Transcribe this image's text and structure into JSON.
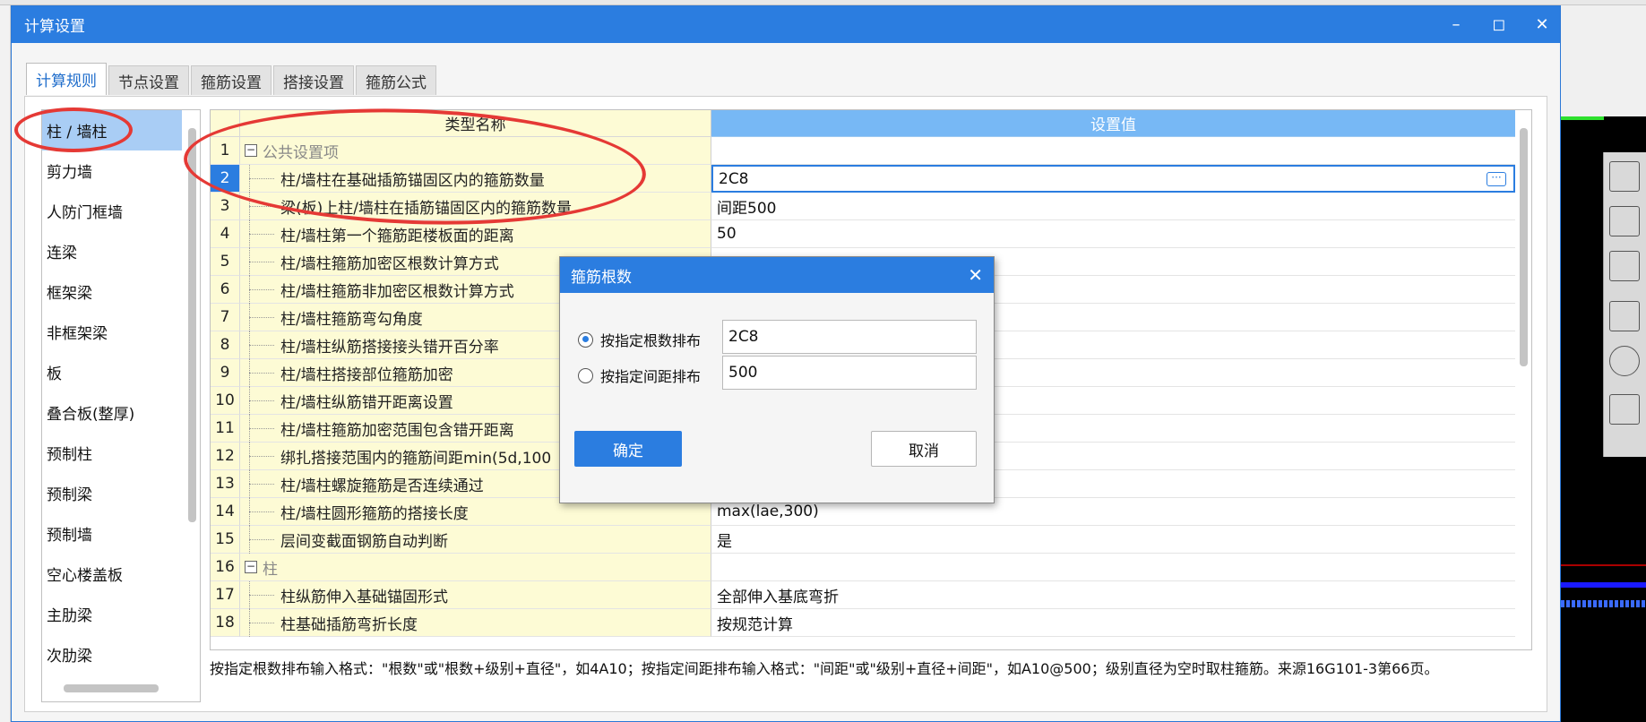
{
  "window": {
    "title": "计算设置"
  },
  "tabs": [
    {
      "label": "计算规则"
    },
    {
      "label": "节点设置"
    },
    {
      "label": "箍筋设置"
    },
    {
      "label": "搭接设置"
    },
    {
      "label": "箍筋公式"
    }
  ],
  "categories": [
    "柱 / 墙柱",
    "剪力墙",
    "人防门框墙",
    "连梁",
    "框架梁",
    "非框架梁",
    "板",
    "叠合板(整厚)",
    "预制柱",
    "预制梁",
    "预制墙",
    "空心楼盖板",
    "主肋梁",
    "次肋梁"
  ],
  "grid": {
    "col_name": "类型名称",
    "col_value": "设置值",
    "rows": [
      {
        "num": "1",
        "name": "公共设置项",
        "value": "",
        "group": true
      },
      {
        "num": "2",
        "name": "柱/墙柱在基础插筋锚固区内的箍筋数量",
        "value": "2C8",
        "selected": true
      },
      {
        "num": "3",
        "name": "梁(板)上柱/墙柱在插筋锚固区内的箍筋数量",
        "value": "间距500"
      },
      {
        "num": "4",
        "name": "柱/墙柱第一个箍筋距楼板面的距离",
        "value": "50"
      },
      {
        "num": "5",
        "name": "柱/墙柱箍筋加密区根数计算方式",
        "value": ""
      },
      {
        "num": "6",
        "name": "柱/墙柱箍筋非加密区根数计算方式",
        "value": ""
      },
      {
        "num": "7",
        "name": "柱/墙柱箍筋弯勾角度",
        "value": ""
      },
      {
        "num": "8",
        "name": "柱/墙柱纵筋搭接接头错开百分率",
        "value": ""
      },
      {
        "num": "9",
        "name": "柱/墙柱搭接部位箍筋加密",
        "value": ""
      },
      {
        "num": "10",
        "name": "柱/墙柱纵筋错开距离设置",
        "value": ""
      },
      {
        "num": "11",
        "name": "柱/墙柱箍筋加密范围包含错开距离",
        "value": ""
      },
      {
        "num": "12",
        "name": "绑扎搭接范围内的箍筋间距min(5d,100",
        "value": ""
      },
      {
        "num": "13",
        "name": "柱/墙柱螺旋箍筋是否连续通过",
        "value": ""
      },
      {
        "num": "14",
        "name": "柱/墙柱圆形箍筋的搭接长度",
        "value": "max(lae,300)"
      },
      {
        "num": "15",
        "name": "层间变截面钢筋自动判断",
        "value": "是"
      },
      {
        "num": "16",
        "name": "柱",
        "value": "",
        "group": true
      },
      {
        "num": "17",
        "name": "柱纵筋伸入基础锚固形式",
        "value": "全部伸入基底弯折"
      },
      {
        "num": "18",
        "name": "柱基础插筋弯折长度",
        "value": "按规范计算"
      }
    ]
  },
  "help_text": "按指定根数排布输入格式：\"根数\"或\"根数+级别+直径\"，如4A10；按指定间距排布输入格式：\"间距\"或\"级别+直径+间距\"，如A10@500；级别直径为空时取柱箍筋。来源16G101-3第66页。",
  "dialog": {
    "title": "箍筋根数",
    "option1_label": "按指定根数排布",
    "option1_value": "2C8",
    "option2_label": "按指定间距排布",
    "option2_value": "500",
    "ok_label": "确定",
    "cancel_label": "取消"
  },
  "icons": {
    "minimize": "minimize-icon",
    "maximize": "maximize-icon",
    "close": "close-icon",
    "collapse": "collapse-icon",
    "ellipsis": "ellipsis-icon"
  },
  "colors": {
    "accent": "#2b7de0",
    "header_value": "#77b8f5",
    "name_column": "#fdfbd5",
    "selected_category": "#a9cdf5",
    "annotation": "#e53935"
  }
}
